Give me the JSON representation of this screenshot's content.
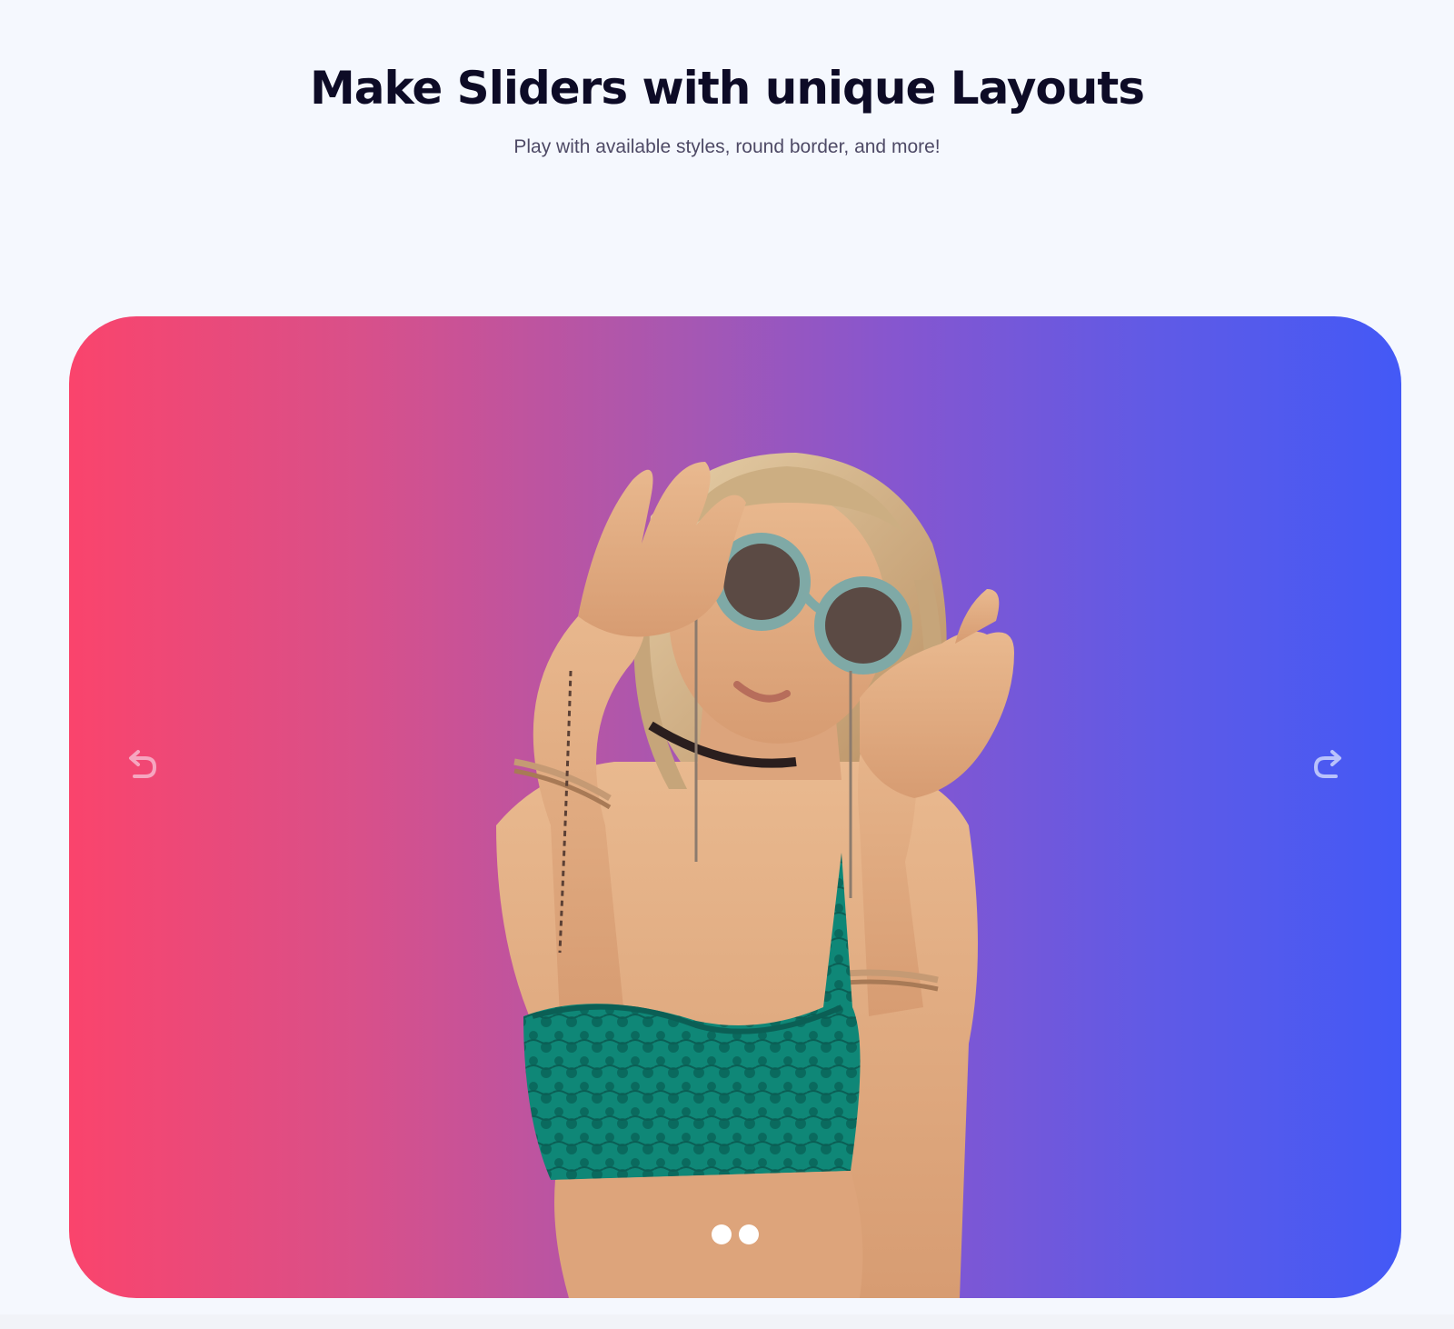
{
  "header": {
    "title": "Make Sliders with unique Layouts",
    "subtitle": "Play with available styles, round border, and more!"
  },
  "slider": {
    "gradient_colors": [
      "#fa446c",
      "#a957b0",
      "#4359f6"
    ],
    "prev_icon": "undo-arrow-icon",
    "next_icon": "redo-arrow-icon",
    "slide_image": "woman-with-round-sunglasses",
    "pagination": {
      "total": 2,
      "active_index": 0
    }
  },
  "colors": {
    "background": "#f5f8fe",
    "title": "#0d0b26",
    "subtitle": "#4e4a66",
    "top_color": "#0e8a78"
  }
}
